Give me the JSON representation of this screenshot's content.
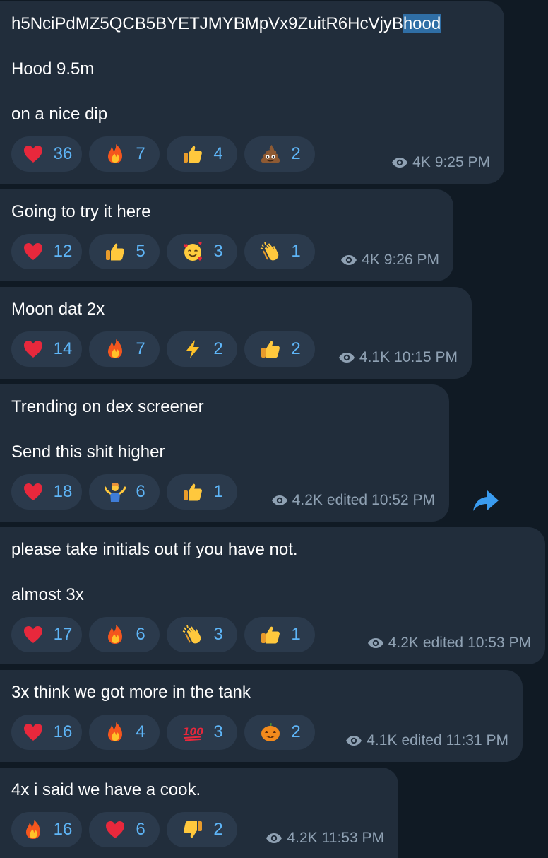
{
  "colors": {
    "background": "#101a24",
    "bubble": "#212d3b",
    "reaction_chip": "#2b3a4c",
    "reaction_count": "#5eb5f7",
    "meta_text": "#8fa1b3",
    "selection": "#2f6ea5"
  },
  "messages": [
    {
      "lines": [
        "h5NciPdMZ5QCB5BYETJMYBMpVx9ZuitR6HcVjyB",
        "Hood 9.5m",
        "on a nice dip"
      ],
      "selected_text": "hood",
      "reactions": [
        {
          "icon": "heart-icon",
          "count": "36"
        },
        {
          "icon": "fire-icon",
          "count": "7"
        },
        {
          "icon": "thumbs-up-icon",
          "count": "4"
        },
        {
          "icon": "poop-icon",
          "count": "2"
        }
      ],
      "views": "4K",
      "edited": "",
      "time": "9:25 PM"
    },
    {
      "lines": [
        "Going to try it here"
      ],
      "reactions": [
        {
          "icon": "heart-icon",
          "count": "12"
        },
        {
          "icon": "thumbs-up-icon",
          "count": "5"
        },
        {
          "icon": "smiling-face-with-hearts-icon",
          "count": "3"
        },
        {
          "icon": "clapping-hands-icon",
          "count": "1"
        }
      ],
      "views": "4K",
      "edited": "",
      "time": "9:26 PM"
    },
    {
      "lines": [
        "Moon dat 2x"
      ],
      "reactions": [
        {
          "icon": "heart-icon",
          "count": "14"
        },
        {
          "icon": "fire-icon",
          "count": "7"
        },
        {
          "icon": "lightning-icon",
          "count": "2"
        },
        {
          "icon": "thumbs-up-icon",
          "count": "2"
        }
      ],
      "views": "4.1K",
      "edited": "",
      "time": "10:15 PM"
    },
    {
      "lines": [
        "Trending on dex screener",
        "Send this shit higher"
      ],
      "reactions": [
        {
          "icon": "heart-icon",
          "count": "18"
        },
        {
          "icon": "person-shrugging-icon",
          "count": "6"
        },
        {
          "icon": "thumbs-up-icon",
          "count": "1"
        }
      ],
      "views": "4.2K",
      "edited": "edited",
      "time": "10:52 PM"
    },
    {
      "lines": [
        "please take initials out if you have not.",
        "almost 3x"
      ],
      "reactions": [
        {
          "icon": "heart-icon",
          "count": "17"
        },
        {
          "icon": "fire-icon",
          "count": "6"
        },
        {
          "icon": "clapping-hands-icon",
          "count": "3"
        },
        {
          "icon": "thumbs-up-icon",
          "count": "1"
        }
      ],
      "views": "4.2K",
      "edited": "edited",
      "time": "10:53 PM"
    },
    {
      "lines": [
        "3x think we got more in the tank"
      ],
      "reactions": [
        {
          "icon": "heart-icon",
          "count": "16"
        },
        {
          "icon": "fire-icon",
          "count": "4"
        },
        {
          "icon": "hundred-points-icon",
          "count": "3"
        },
        {
          "icon": "jack-o-lantern-icon",
          "count": "2"
        }
      ],
      "views": "4.1K",
      "edited": "edited",
      "time": "11:31 PM"
    },
    {
      "lines": [
        "4x i said we have a cook."
      ],
      "reactions": [
        {
          "icon": "fire-icon",
          "count": "16"
        },
        {
          "icon": "heart-icon",
          "count": "6"
        },
        {
          "icon": "thumbs-down-icon",
          "count": "2"
        }
      ],
      "views": "4.2K",
      "edited": "",
      "time": "11:53 PM"
    }
  ],
  "share_icon": "forward-arrow-icon"
}
